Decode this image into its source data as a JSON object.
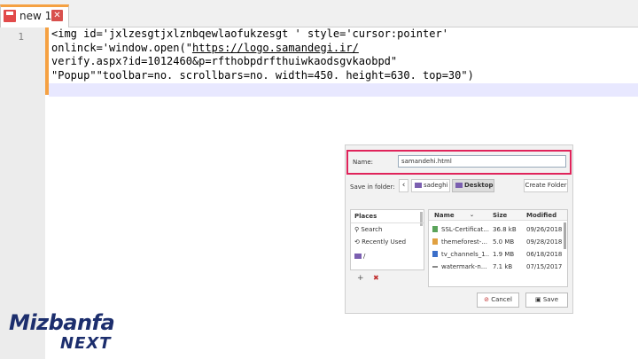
{
  "tab": {
    "label": "new 1",
    "close": "✕"
  },
  "editor": {
    "line_number": "1",
    "lines": [
      "<img id='jxlzesgtjxlznbqewlaofukzesgt ' style='cursor:pointer'",
      "onlinck='window.open(\"",
      "https://logo.samandegi.ir/",
      "verify.aspx?id=1012460&p=rfthobpdrfthuiwkaodsgvkaobpd\"",
      "\"Popup\"\"toolbar=no. scrollbars=no. width=450. height=630. top=30\")"
    ]
  },
  "dialog": {
    "name_label": "Name:",
    "name_value": "samandehi.html",
    "folder_label": "Save in folder:",
    "back": "‹",
    "crumbs": [
      "sadeghi",
      "Desktop"
    ],
    "create_folder": "Create Folder",
    "places": {
      "header": "Places",
      "items": [
        {
          "icon": "search-icon",
          "label": "Search"
        },
        {
          "icon": "recent-icon",
          "label": "Recently Used"
        },
        {
          "icon": "drive-icon",
          "label": "/"
        }
      ],
      "add": "+",
      "remove": "✖"
    },
    "files": {
      "columns": [
        "Name",
        "Size",
        "Modified"
      ],
      "rows": [
        {
          "name": "SSL-Certificat...",
          "size": "36.8 kB",
          "modified": "09/26/2018"
        },
        {
          "name": "themeforest-...",
          "size": "5.0 MB",
          "modified": "09/28/2018"
        },
        {
          "name": "tv_channels_1...",
          "size": "1.9 MB",
          "modified": "06/18/2018"
        },
        {
          "name": "watermark-n...",
          "size": "7.1 kB",
          "modified": "07/15/2017"
        }
      ]
    },
    "cancel": "Cancel",
    "save": "Save"
  },
  "logo": {
    "top": "Mizbanfa",
    "bottom": "NEXT",
    "color": "#1c2e6d"
  },
  "colors": {
    "accent": "#f5a142",
    "highlight": "#e0245b"
  }
}
